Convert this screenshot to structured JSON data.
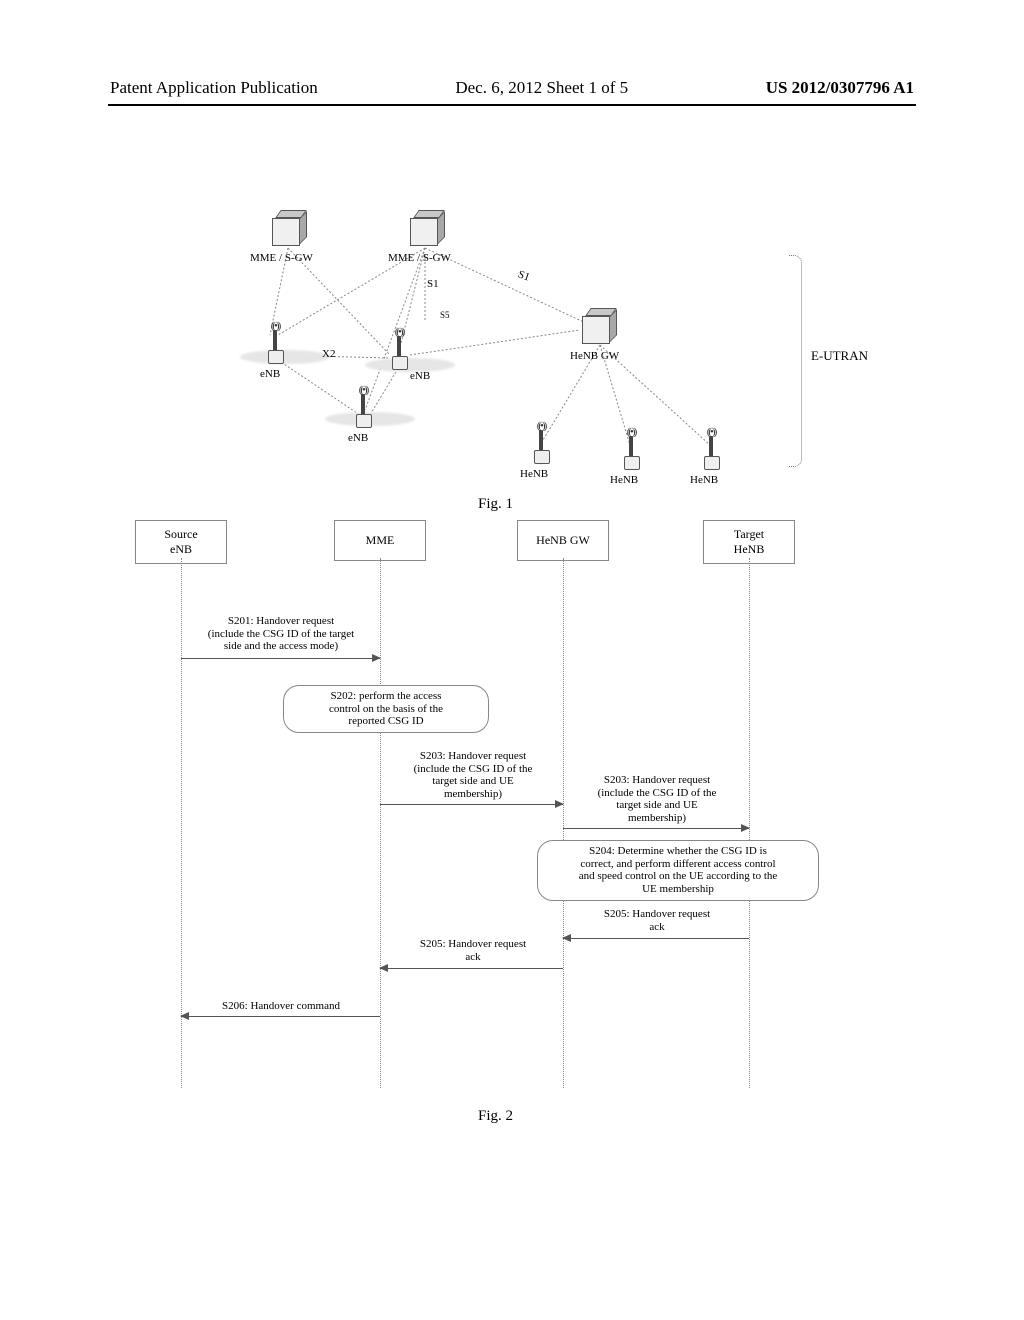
{
  "header": {
    "left": "Patent Application Publication",
    "mid": "Dec. 6, 2012  Sheet 1 of 5",
    "right": "US 2012/0307796 A1"
  },
  "fig1": {
    "nodes": {
      "mme_sgw_1": "MME / S-GW",
      "mme_sgw_2": "MME / S-GW",
      "henb_gw": "HeNB GW",
      "enb_1": "eNB",
      "enb_2": "eNB",
      "enb_3": "eNB",
      "henb_1": "HeNB",
      "henb_2": "HeNB",
      "henb_3": "HeNB",
      "eutran": "E-UTRAN",
      "link_x2": "X2",
      "link_s1": "S1",
      "link_s5": "S5"
    },
    "caption": "Fig. 1"
  },
  "fig2": {
    "actors": {
      "src": "Source\neNB",
      "mme": "MME",
      "gw": "HeNB GW",
      "tgt": "Target\nHeNB"
    },
    "messages": {
      "s201": "S201: Handover request\n(include the CSG ID of the target\nside and the access mode)",
      "s202": "S202: perform the access\ncontrol on the basis of the\nreported CSG ID",
      "s203a": "S203: Handover request\n(include the CSG ID of the\ntarget side and UE\nmembership)",
      "s203b": "S203: Handover request\n(include the CSG ID of the\ntarget side and UE\nmembership)",
      "s204": "S204: Determine whether the CSG ID is\ncorrect, and perform different access control\nand speed control on the UE according to the\nUE membership",
      "s205a": "S205: Handover request\nack",
      "s205b": "S205: Handover request\nack",
      "s206": "S206: Handover command"
    },
    "caption": "Fig. 2"
  }
}
